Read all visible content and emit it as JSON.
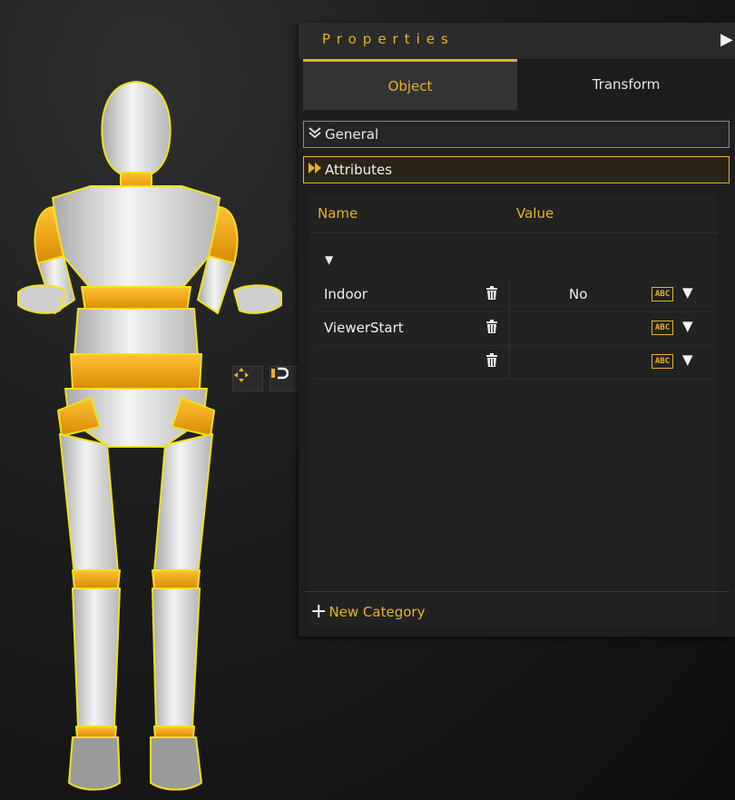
{
  "panel": {
    "title": "Properties",
    "collapse_icon": "triangle-right-icon",
    "tabs": [
      {
        "label": "Object",
        "active": true
      },
      {
        "label": "Transform",
        "active": false
      }
    ],
    "sections": {
      "general": {
        "label": "General",
        "icon": "double-chevron-down-icon"
      },
      "attributes": {
        "label": "Attributes",
        "icon": "double-chevron-right-icon"
      }
    },
    "table": {
      "col_name": "Name",
      "col_value": "Value",
      "group_toggle": "▼",
      "rows": [
        {
          "name": "Indoor",
          "value": "No",
          "type": "ABC"
        },
        {
          "name": "ViewerStart",
          "value": "",
          "type": "ABC"
        },
        {
          "name": "",
          "value": "",
          "type": "ABC"
        }
      ]
    },
    "new_category": "New Category"
  },
  "gizmo": {
    "buttons": [
      "move-icon",
      "snap-icon",
      "layer-icon",
      "arrow-up-icon",
      "arrow-down-icon",
      "orbit-icon"
    ]
  },
  "colors": {
    "accent": "#e6b22a",
    "panel_bg": "#1e1e1e",
    "selection_outline": "#f0e020"
  }
}
